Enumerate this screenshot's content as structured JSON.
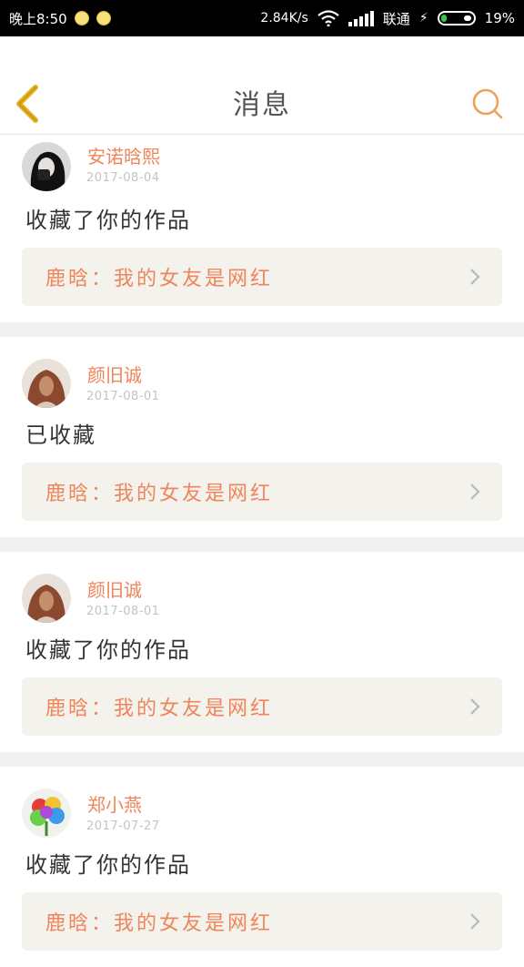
{
  "status_bar": {
    "time": "晚上8:50",
    "net_speed": "2.84K/s",
    "carrier": "联通",
    "battery": "19%",
    "battery_level": 0.19
  },
  "header": {
    "title": "消息"
  },
  "messages": [
    {
      "user": "安诺晗熙",
      "date": "2017-08-04",
      "action": "收藏了你的作品",
      "work": "鹿晗：我的女友是网红"
    },
    {
      "user": "颜旧诚",
      "date": "2017-08-01",
      "action": "已收藏",
      "work": "鹿晗：我的女友是网红"
    },
    {
      "user": "颜旧诚",
      "date": "2017-08-01",
      "action": "收藏了你的作品",
      "work": "鹿晗：我的女友是网红"
    },
    {
      "user": "郑小燕",
      "date": "2017-07-27",
      "action": "收藏了你的作品",
      "work": "鹿晗：我的女友是网红"
    }
  ],
  "colors": {
    "accent": "#f0845a",
    "back_icon": "#e7b21f",
    "card_bg": "#f3f2ec",
    "separator": "#f1f1f1"
  }
}
